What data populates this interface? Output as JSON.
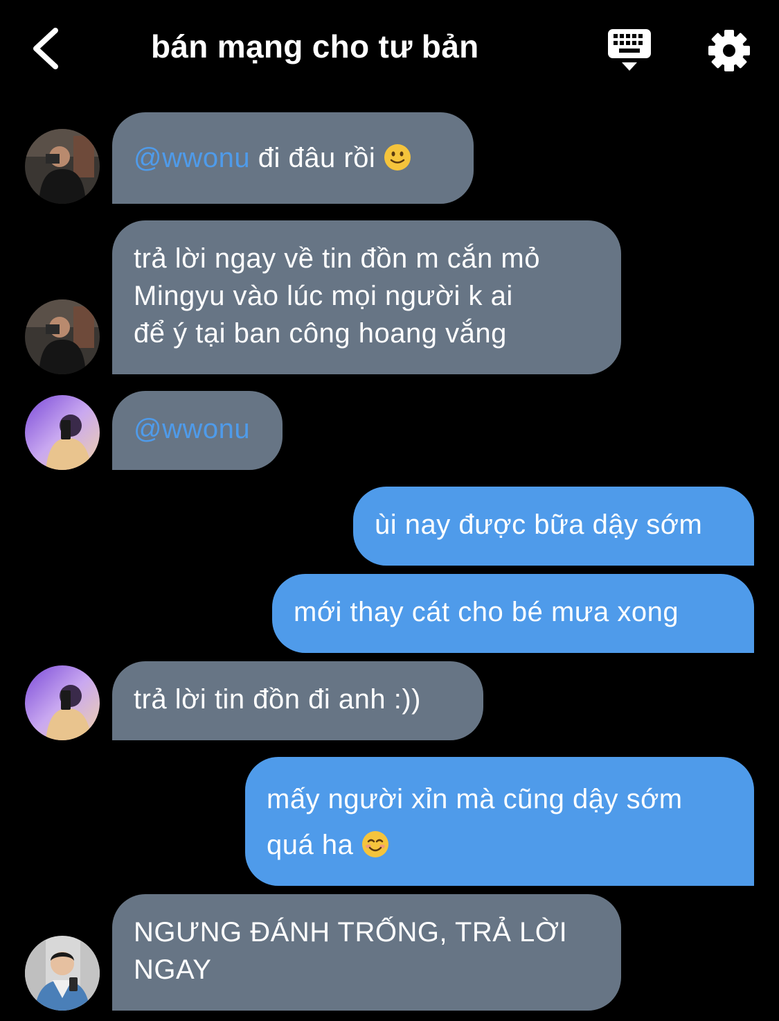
{
  "header": {
    "title": "bán mạng cho tư bản",
    "back_icon": "chevron-left-icon",
    "keyboard_icon": "keyboard-hide-icon",
    "settings_icon": "gear-icon"
  },
  "colors": {
    "background": "#000000",
    "incoming_bubble": "#677585",
    "outgoing_bubble": "#4f9bea",
    "mention": "#4f9bea"
  },
  "messages": [
    {
      "direction": "incoming",
      "mention": "@wwonu",
      "text": " đi đâu rồi",
      "emoji": "slightly-smiling-face-icon"
    },
    {
      "direction": "incoming",
      "lines": [
        "trả lời ngay về tin đồn m cắn mỏ",
        "Mingyu vào lúc mọi người k ai",
        "để ý tại ban công hoang vắng"
      ]
    },
    {
      "direction": "incoming",
      "mention": "@wwonu"
    },
    {
      "direction": "outgoing",
      "text": "ùi nay được bữa dậy sớm"
    },
    {
      "direction": "outgoing",
      "text": "mới thay cát cho bé mưa xong"
    },
    {
      "direction": "incoming",
      "text": "trả lời tin đồn đi anh :))"
    },
    {
      "direction": "outgoing",
      "lines": [
        "mấy người xỉn mà cũng dậy sớm",
        "quá ha"
      ],
      "emoji": "smiling-face-icon"
    },
    {
      "direction": "incoming",
      "lines": [
        "NGƯNG ĐÁNH TRỐNG, TRẢ LỜI",
        "NGAY"
      ]
    }
  ]
}
